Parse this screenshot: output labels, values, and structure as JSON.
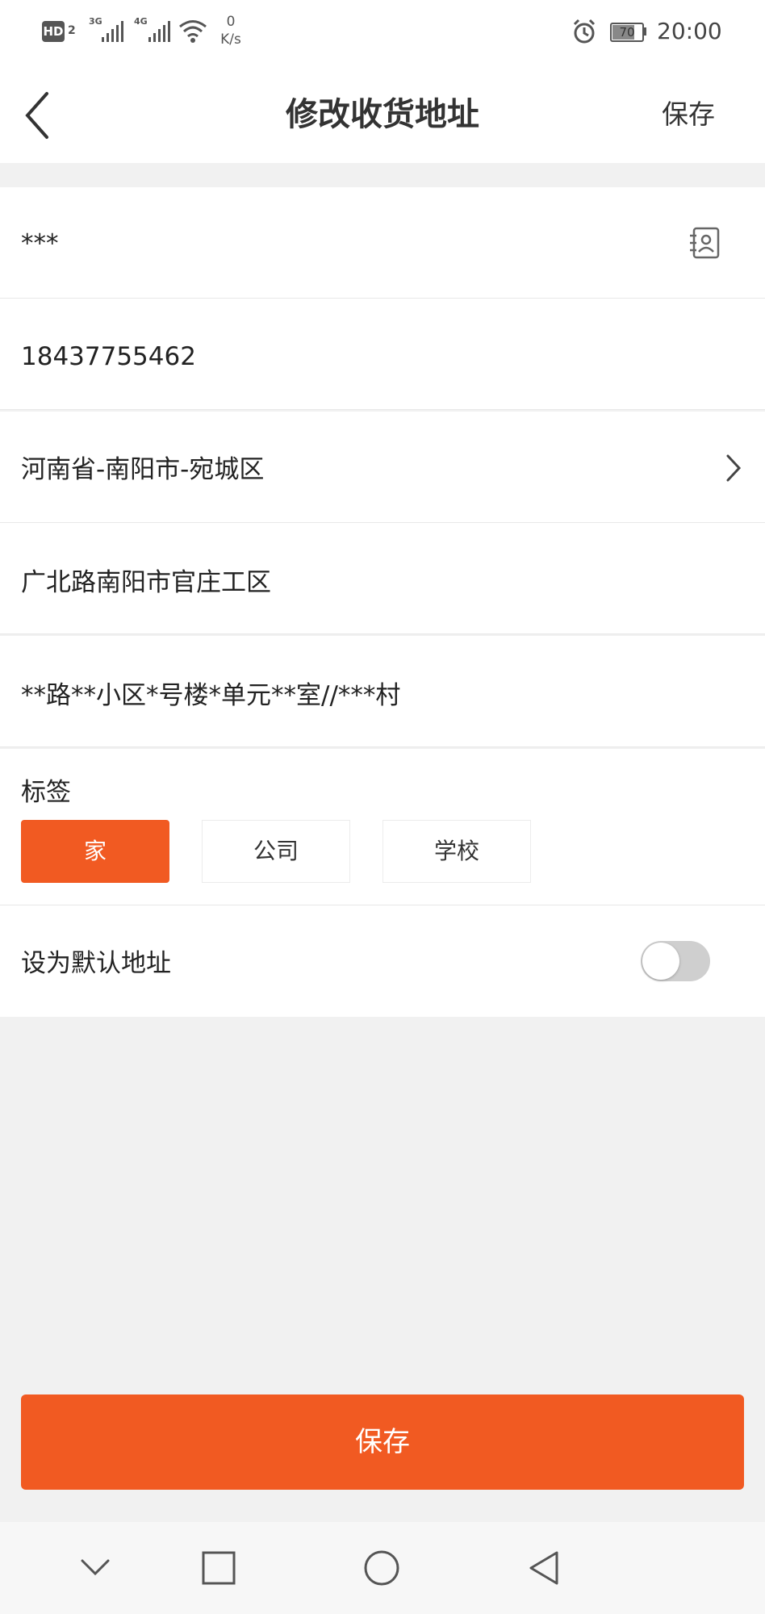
{
  "status_bar": {
    "hd_label": "HD",
    "hd_sub": "2",
    "net1": "3G",
    "net2": "4G",
    "speed_value": "0",
    "speed_unit": "K/s",
    "battery": "70",
    "time": "20:00"
  },
  "header": {
    "title": "修改收货地址",
    "save_label": "保存"
  },
  "form": {
    "name": "***",
    "phone": "18437755462",
    "region": "河南省-南阳市-宛城区",
    "street": "广北路南阳市官庄工区",
    "detail": "**路**小区*号楼*单元**室//***村"
  },
  "tags": {
    "label": "标签",
    "options": [
      "家",
      "公司",
      "学校"
    ],
    "selected": "家"
  },
  "default_address": {
    "label": "设为默认地址",
    "enabled": false
  },
  "save_button": "保存",
  "colors": {
    "accent": "#f15a22",
    "background": "#f1f1f1"
  },
  "icons": {
    "back": "back-chevron-icon",
    "contacts": "contact-book-icon",
    "region_arrow": "chevron-right-icon",
    "nav": [
      "chevron-down-icon",
      "square-icon",
      "circle-icon",
      "triangle-back-icon"
    ]
  }
}
